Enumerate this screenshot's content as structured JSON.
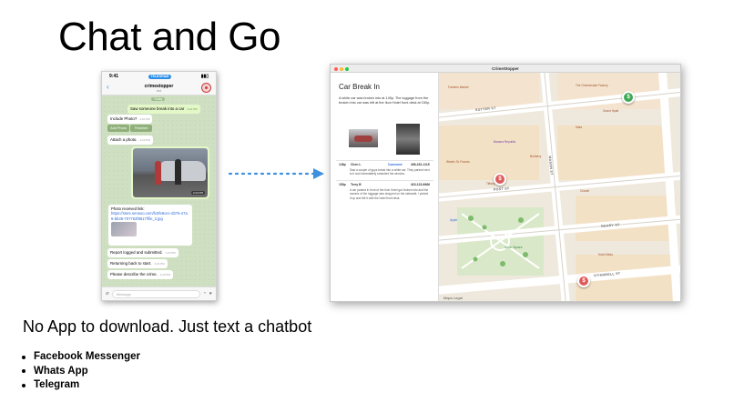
{
  "slide": {
    "title": "Chat and Go",
    "subtitle": "No App to download. Just text a chatbot",
    "bullets": [
      "Facebook Messenger",
      "Whats App",
      "Telegram"
    ]
  },
  "phone": {
    "status_time": "9:41",
    "status_pill": "TELEGRAM",
    "chat_name": "crimestopper",
    "chat_sub": "bot",
    "today": "Today",
    "messages": {
      "m1": "Saw someone break into a car",
      "m1_time": "4:22 PM",
      "m2": "Include Photo?",
      "m2_time": "4:22 PM",
      "btn_add": "Add Photo",
      "btn_finished": "Finished",
      "m3": "Attach a photo.",
      "m3_time": "4:22 PM",
      "photo_time": "4:23 PM",
      "m4_label": "Photo received link:",
      "m4_url": "https://store.sensoo.com/fc0fe8cec-d375-47a6-bb36-707762f6817/file_2.jpg",
      "m4_time": "4:23 PM",
      "m5": "Report logged and submitted.",
      "m5_time": "4:23 PM",
      "m6": "Returning back to start.",
      "m6_time": "4:23 PM",
      "m7": "Please describe the crime.",
      "m7_time": "4:23 PM"
    },
    "input_placeholder": "Message"
  },
  "window": {
    "title": "CrimeStopper",
    "colors": {
      "close": "#ff5f57",
      "min": "#febc2e",
      "max": "#28c840"
    },
    "panel": {
      "title": "Car Break In",
      "description": "A white car was broken into at 145p. The luggage from the broken into car was left at the Ikon Hotel front desk at 150p.",
      "rows": [
        {
          "time": "145p",
          "name": "Chen L",
          "tag": "Comment",
          "phone": "408-232-1115",
          "text": "Saw a couple of guys break into a white car. They parked next to it and immediately smashed the window."
        },
        {
          "time": "150p",
          "name": "Terry B",
          "tag": "",
          "phone": "415-123-6666",
          "text": "A car parked in front of the Ikon Hotel got broken into and the owners of the luggage was dropped on the sidewalk. I picked it up and left it with the hotel front desk."
        }
      ]
    },
    "map": {
      "streets": [
        "SUTTER ST",
        "POST ST",
        "GEARY ST",
        "O'FARRELL ST",
        "MASON ST"
      ],
      "pois": [
        "Farmers Market",
        "Banana Republic",
        "Westin St. Francis",
        "Tiffany & Co.",
        "Union Square",
        "Saks",
        "The Cheesecake Factory",
        "Grand Hyatt",
        "Burberry",
        "Hotel Nikko",
        "Chanel",
        "Apple"
      ],
      "pins": [
        "$",
        "$",
        "$"
      ],
      "legal": "Maps  Legal"
    }
  }
}
